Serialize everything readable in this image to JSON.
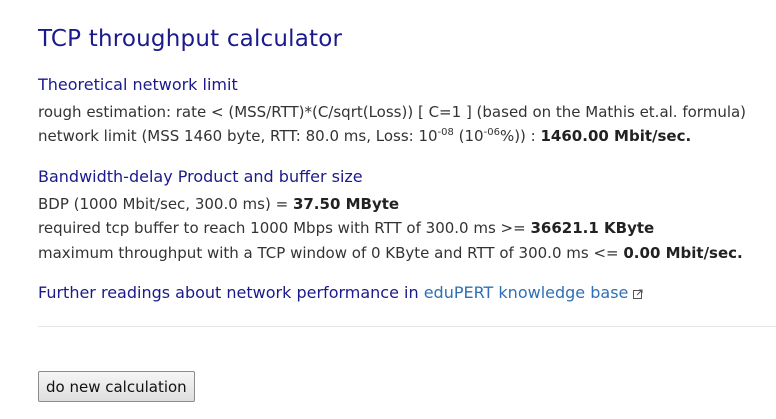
{
  "title": "TCP throughput calculator",
  "theoretical": {
    "heading": "Theoretical network limit",
    "rough": "rough estimation: rate < (MSS/RTT)*(C/sqrt(Loss)) [ C=1 ] (based on the Mathis et.al. formula)",
    "limit_prefix": "network limit (MSS 1460 byte, RTT: 80.0 ms, Loss: 10",
    "loss_exp": "-08",
    "limit_mid": " (10",
    "loss_pct_exp": "-06",
    "limit_suffix": "%)) : ",
    "limit_value": "1460.00 Mbit/sec."
  },
  "bdp": {
    "heading": "Bandwidth-delay Product and buffer size",
    "bdp_prefix": "BDP (1000 Mbit/sec, 300.0 ms) = ",
    "bdp_value": "37.50 MByte",
    "buffer_prefix": "required tcp buffer to reach 1000 Mbps with RTT of 300.0 ms >= ",
    "buffer_value": "36621.1 KByte",
    "max_prefix": "maximum throughput with a TCP window of 0 KByte and RTT of 300.0 ms <= ",
    "max_value": "0.00 Mbit/sec."
  },
  "further": {
    "text": "Further readings about network performance in ",
    "link_label": "eduPERT knowledge base",
    "icon": "external-link-icon"
  },
  "button": {
    "label": "do new calculation"
  }
}
